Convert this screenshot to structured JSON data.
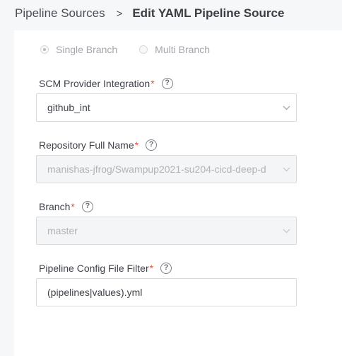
{
  "breadcrumb": {
    "parent": "Pipeline Sources",
    "separator": ">",
    "current": "Edit YAML Pipeline Source"
  },
  "branch_mode": {
    "options": [
      {
        "label": "Single Branch",
        "selected": true
      },
      {
        "label": "Multi Branch",
        "selected": false
      }
    ]
  },
  "fields": {
    "scm": {
      "label": "SCM Provider Integration",
      "required_mark": "*",
      "value": "github_int",
      "help_icon": "question-circle-icon"
    },
    "repo": {
      "label": "Repository Full Name",
      "required_mark": "*",
      "value": "manishas-jfrog/Swampup2021-su204-cicd-deep-d",
      "help_icon": "question-circle-icon"
    },
    "branch": {
      "label": "Branch",
      "required_mark": "*",
      "value": "master",
      "help_icon": "question-circle-icon"
    },
    "filter": {
      "label": "Pipeline Config File Filter",
      "required_mark": "*",
      "value": "(pipelines|values).yml",
      "help_icon": "question-circle-icon"
    }
  },
  "help_glyph": "?",
  "colors": {
    "required": "#e0533f",
    "disabled_bg": "#f4f5f6",
    "border": "#d9dbde"
  }
}
